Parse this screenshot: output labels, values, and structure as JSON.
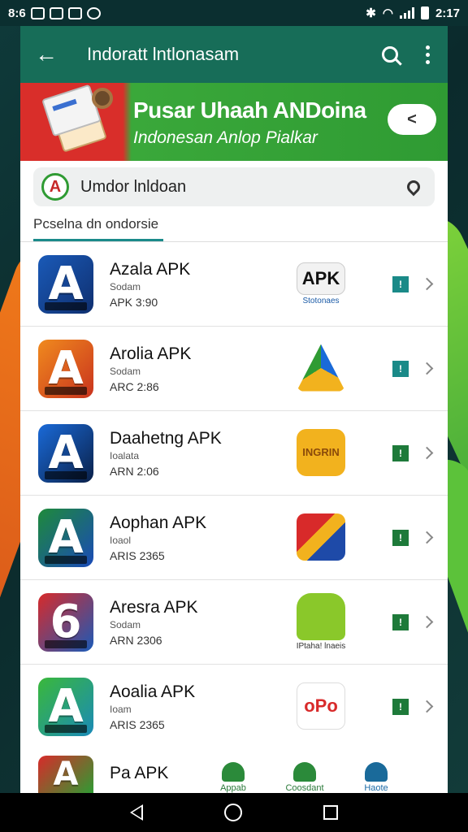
{
  "status_bar": {
    "time_left": "8:6",
    "time_right": "2:17"
  },
  "app_bar": {
    "title": "Indoratt lntlonasam",
    "back_icon": "arrow-left-icon",
    "search_icon": "search-icon",
    "more_icon": "more-vert-icon"
  },
  "banner": {
    "title": "Pusar Uhaah ANDoina",
    "subtitle": "Indonesan Anlop Pialkar",
    "share_icon": "share-icon"
  },
  "search": {
    "value": "Umdor lnldoan",
    "logo_letter": "A",
    "location_icon": "location-pin-icon"
  },
  "section": {
    "label": "Pcselna dn ondorsie"
  },
  "apps": [
    {
      "name": "Azala APK",
      "sub": "Sodam",
      "version": "APK 3:90",
      "icon_letter": "A",
      "icon_colors": [
        "#1a5ab8",
        "#0f2f6f"
      ],
      "thumb_text": "APK",
      "thumb_bg": "#f2f2f2",
      "thumb_color": "#111",
      "caption": "Stotonaes",
      "dl_icon": "download-icon",
      "chevron_icon": "chevron-right-icon"
    },
    {
      "name": "Arolia APK",
      "sub": "Sodam",
      "version": "ARC 2:86",
      "icon_letter": "A",
      "icon_colors": [
        "#f08a1e",
        "#c9331e"
      ],
      "thumb_text": "",
      "thumb_bg": "#ffffff",
      "thumb_color": "#111",
      "caption": "",
      "dl_icon": "download-icon",
      "chevron_icon": "chevron-right-icon"
    },
    {
      "name": "Daahetng APK",
      "sub": "Ioalata",
      "version": "ARN 2:06",
      "icon_letter": "A",
      "icon_colors": [
        "#1a6ad8",
        "#0a2048"
      ],
      "thumb_text": "INGRIN",
      "thumb_bg": "#f2b21e",
      "thumb_color": "#8a4a0a",
      "caption": "",
      "dl_icon": "download-icon",
      "chevron_icon": "chevron-right-icon"
    },
    {
      "name": "Aophan APK",
      "sub": "Ioaol",
      "version": "ARIS 2365",
      "icon_letter": "A",
      "icon_colors": [
        "#1e8a3a",
        "#1a4ab8"
      ],
      "thumb_text": "",
      "thumb_bg": "#1e4aa8",
      "thumb_color": "#fff",
      "caption": "",
      "dl_icon": "download-icon",
      "chevron_icon": "chevron-right-icon"
    },
    {
      "name": "Aresra APK",
      "sub": "Sodam",
      "version": "ARN 2306",
      "icon_letter": "6",
      "icon_colors": [
        "#d82a2a",
        "#1a5ab8"
      ],
      "thumb_text": "",
      "thumb_bg": "#8ac82a",
      "thumb_color": "#fff",
      "caption": "IPtaha! lnaeis",
      "dl_icon": "download-icon",
      "chevron_icon": "chevron-right-icon"
    },
    {
      "name": "Aoalia APK",
      "sub": "Ioam",
      "version": "ARIS 2365",
      "icon_letter": "A",
      "icon_colors": [
        "#3ab83a",
        "#1a8ab8"
      ],
      "thumb_text": "oPo",
      "thumb_bg": "#ffffff",
      "thumb_color": "#d82a2a",
      "caption": "",
      "dl_icon": "download-icon",
      "chevron_icon": "chevron-right-icon"
    }
  ],
  "partial_app": {
    "name": "Pa APK"
  },
  "bottom_nav": [
    {
      "label": "Appab",
      "icon": "robot-icon",
      "color": "#2b8a3a"
    },
    {
      "label": "Coosdant",
      "icon": "android-icon",
      "color": "#2b8a3a"
    },
    {
      "label": "Haote",
      "icon": "person-icon",
      "color": "#1a6a9a"
    }
  ]
}
